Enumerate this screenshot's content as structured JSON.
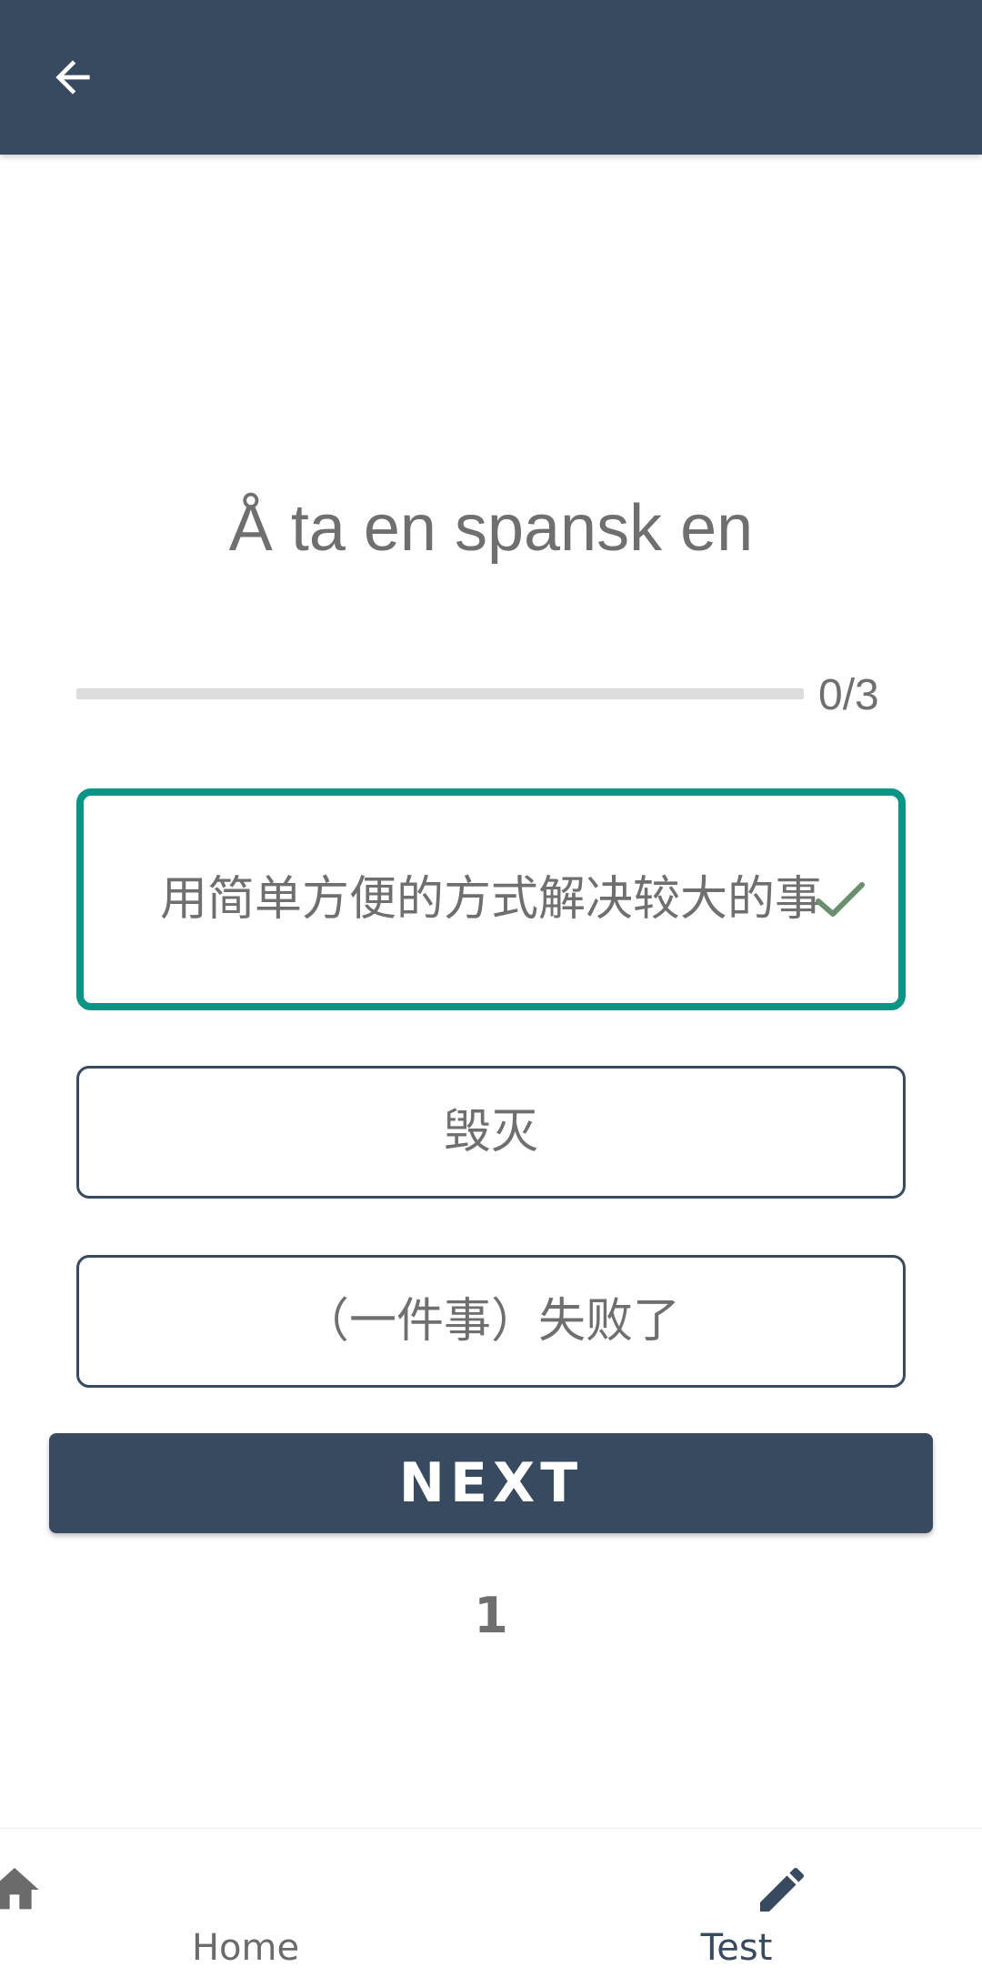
{
  "appbar": {
    "back_icon": "arrow-back-icon",
    "background_color": "#374a5f"
  },
  "question": {
    "word": "Å ta en spansk en"
  },
  "progress": {
    "text": "0/3",
    "fraction": 0
  },
  "options": [
    {
      "text": "用简单方便的方式解决较大的事",
      "selected": true,
      "correct": true,
      "border_color": "#089585"
    },
    {
      "text": "毁灭",
      "selected": false
    },
    {
      "text": "（一件事）失败了",
      "selected": false
    }
  ],
  "next_button": {
    "label": "NEXT"
  },
  "counter": "1",
  "bottom_nav": {
    "items": [
      {
        "label": "Home",
        "icon": "home-icon",
        "active": false
      },
      {
        "label": "Test",
        "icon": "pencil-icon",
        "active": true
      }
    ]
  },
  "colors": {
    "primary": "#374a5f",
    "accent_correct": "#089585",
    "check": "#6a8f6e",
    "text_gray": "#6f6f6f"
  }
}
